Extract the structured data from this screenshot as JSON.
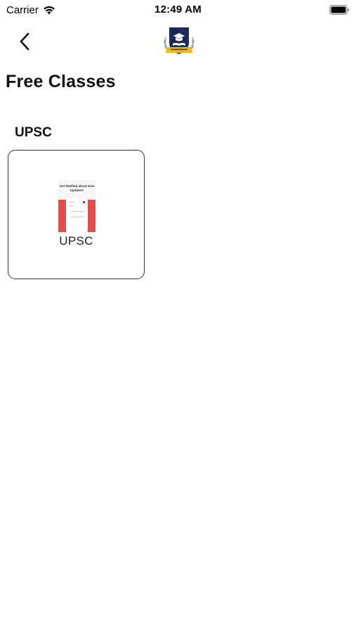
{
  "status_bar": {
    "carrier": "Carrier",
    "time": "12:49 AM",
    "icons": [
      "wifi-icon",
      "battery-icon"
    ]
  },
  "nav": {
    "back_icon": "chevron-left-icon",
    "logo_icon": "academy-crest-logo"
  },
  "page": {
    "title": "Free Classes"
  },
  "section": {
    "heading": "UPSC",
    "cards": [
      {
        "label": "UPSC",
        "thumbnail": {
          "headline": "Get Notified about New Updates!"
        }
      }
    ]
  },
  "colors": {
    "background": "#ffffff",
    "text": "#111111",
    "card_border": "#333333",
    "thumbnail_accent": "#e94a4a",
    "logo_navy": "#1c2a5a",
    "logo_gold": "#f2b705"
  }
}
